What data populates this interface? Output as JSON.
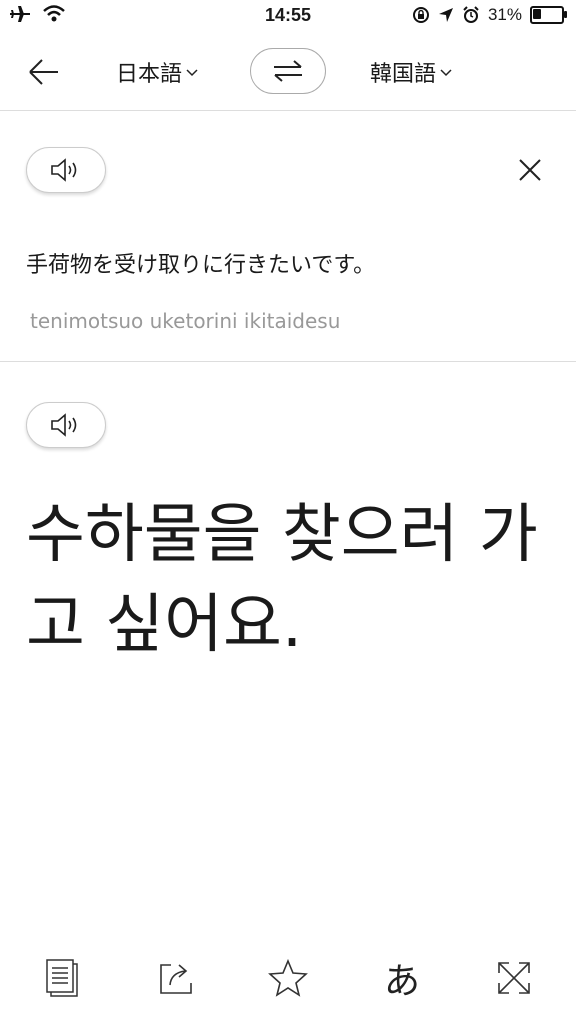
{
  "status_bar": {
    "time": "14:55",
    "battery_percent": "31%",
    "battery_level": 0.31
  },
  "toolbar": {
    "source_language": "日本語",
    "target_language": "韓国語"
  },
  "source": {
    "text": "手荷物を受け取りに行きたいです。",
    "romanization": "tenimotsuo uketorini ikitaidesu"
  },
  "target": {
    "text": "수하물을 찾으러 가고 싶어요."
  },
  "bottom_bar": {
    "hiragana_label": "あ"
  }
}
